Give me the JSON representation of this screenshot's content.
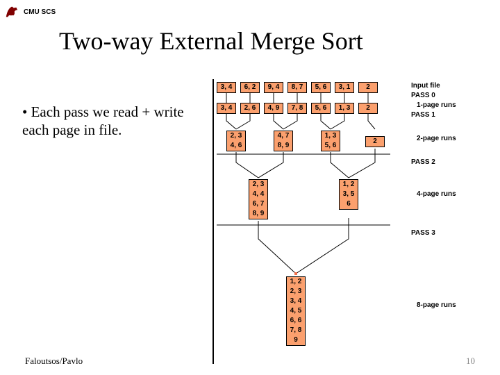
{
  "header": {
    "course": "CMU SCS"
  },
  "title": "Two-way External Merge Sort",
  "bullet": "• Each pass we read + write each page in file.",
  "labels": {
    "input_file": "Input file",
    "pass0": "PASS 0",
    "r1": "1-page runs",
    "pass1": "PASS 1",
    "r2": "2-page runs",
    "pass2": "PASS 2",
    "r4": "4-page runs",
    "pass3": "PASS 3",
    "r8": "8-page runs"
  },
  "rows": {
    "input": [
      "3, 4",
      "6, 2",
      "9, 4",
      "8, 7",
      "5, 6",
      "3, 1",
      "2"
    ],
    "after0": [
      "3, 4",
      "2, 6",
      "4, 9",
      "7, 8",
      "5, 6",
      "1, 3",
      "2"
    ],
    "pass1": {
      "a": [
        "2, 3",
        "4, 6"
      ],
      "b": [
        "4, 7",
        "8, 9"
      ],
      "c": [
        "1, 3",
        "5, 6"
      ],
      "d": [
        "2"
      ]
    },
    "pass2": {
      "a": [
        "2, 3",
        "4, 4",
        "6, 7",
        "8, 9"
      ],
      "b": [
        "1, 2",
        "3, 5",
        "6"
      ]
    },
    "pass3": [
      "1, 2",
      "2, 3",
      "3, 4",
      "4, 5",
      "6, 6",
      "7, 8",
      "9"
    ]
  },
  "footer": {
    "authors": "Faloutsos/Pavlo",
    "page": "10"
  }
}
